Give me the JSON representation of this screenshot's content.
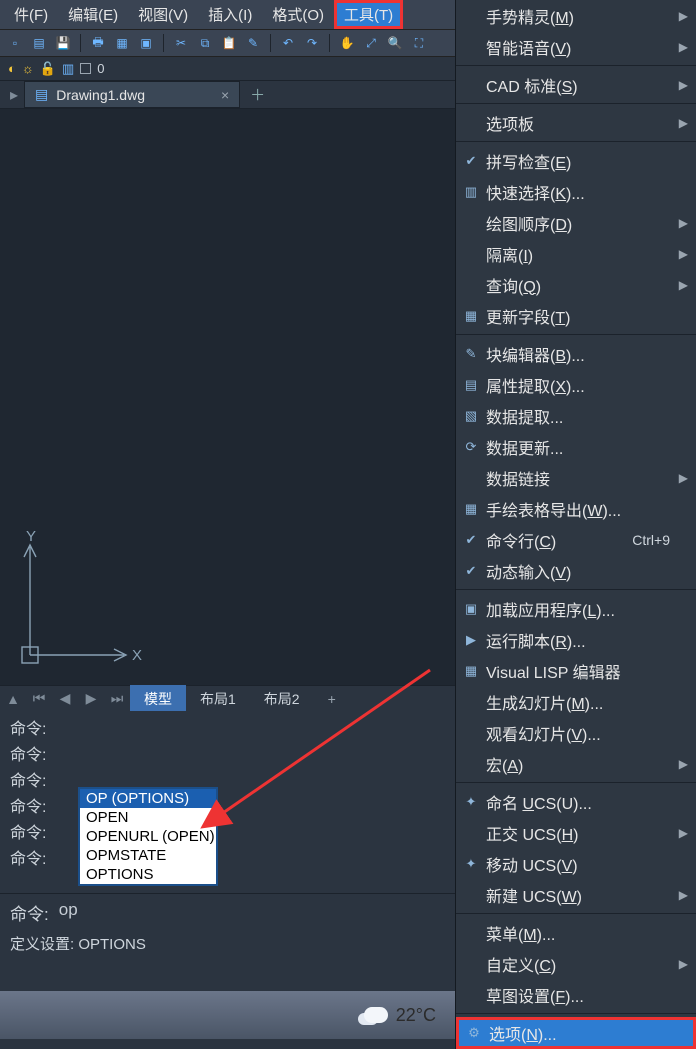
{
  "menubar": {
    "file": "件(F)",
    "edit": "编辑(E)",
    "view": "视图(V)",
    "insert": "插入(I)",
    "format": "格式(O)",
    "tools": "工具(T)"
  },
  "layerbar": {
    "zero": "0"
  },
  "file_tab": {
    "name": "Drawing1.dwg",
    "close": "×",
    "new": "＋"
  },
  "axis": {
    "x": "X",
    "y": "Y"
  },
  "layout_tabs": {
    "model": "模型",
    "layout1": "布局1",
    "layout2": "布局2",
    "plus": "+"
  },
  "cmd": {
    "prompt": "命令:",
    "input_label": "命令:",
    "input_value": "op",
    "status": "定义设置: OPTIONS"
  },
  "autocomplete": {
    "items": [
      "OP (OPTIONS)",
      "OPEN",
      "OPENURL (OPEN)",
      "OPMSTATE",
      "OPTIONS"
    ],
    "selected_index": 0
  },
  "taskbar": {
    "temperature": "22°C"
  },
  "menu": {
    "gesture": {
      "label": "手势精灵(M)",
      "under": "M",
      "arrow": true
    },
    "voice": {
      "label": "智能语音(V)",
      "under": "V",
      "arrow": true
    },
    "cad_std": {
      "label": "CAD 标准(S)",
      "under": "S",
      "arrow": true
    },
    "palettes": {
      "label": "选项板",
      "arrow": true
    },
    "spellcheck": {
      "label": "拼写检查(E)",
      "under": "E"
    },
    "quickselect": {
      "label": "快速选择(K)...",
      "under": "K"
    },
    "draworder": {
      "label": "绘图顺序(D)",
      "under": "D",
      "arrow": true
    },
    "isolate": {
      "label": "隔离(I)",
      "under": "I",
      "arrow": true
    },
    "inquiry": {
      "label": "查询(Q)",
      "under": "Q",
      "arrow": true
    },
    "field": {
      "label": "更新字段(T)",
      "under": "T"
    },
    "blockedit": {
      "label": "块编辑器(B)...",
      "under": "B"
    },
    "attrextract": {
      "label": "属性提取(X)...",
      "under": "X"
    },
    "dataextract": {
      "label": "数据提取..."
    },
    "dataupdate": {
      "label": "数据更新..."
    },
    "datalink": {
      "label": "数据链接",
      "arrow": true
    },
    "handtable": {
      "label": "手绘表格导出(W)...",
      "under": "W"
    },
    "cmdline": {
      "label": "命令行(C)",
      "under": "C",
      "accel": "Ctrl+9"
    },
    "dyninput": {
      "label": "动态输入(V)",
      "under": "V"
    },
    "loadapp": {
      "label": "加载应用程序(L)...",
      "under": "L"
    },
    "runscript": {
      "label": "运行脚本(R)...",
      "under": "R"
    },
    "vlisp": {
      "label": "Visual LISP 编辑器"
    },
    "mkslide": {
      "label": "生成幻灯片(M)...",
      "under": "M"
    },
    "viewslide": {
      "label": "观看幻灯片(V)...",
      "under": "V"
    },
    "macro": {
      "label": "宏(A)",
      "under": "A",
      "arrow": true
    },
    "namedUCS": {
      "label": "命名 UCS(U)...",
      "under": "U"
    },
    "orthoUCS": {
      "label": "正交 UCS(H)",
      "under": "H",
      "arrow": true
    },
    "moveUCS": {
      "label": "移动 UCS(V)",
      "under": "V"
    },
    "newUCS": {
      "label": "新建 UCS(W)",
      "under": "W",
      "arrow": true
    },
    "menus": {
      "label": "菜单(M)...",
      "under": "M"
    },
    "customize": {
      "label": "自定义(C)",
      "under": "C",
      "arrow": true
    },
    "drafting": {
      "label": "草图设置(F)...",
      "under": "F"
    },
    "options": {
      "label": "选项(N)...",
      "under": "N"
    }
  }
}
